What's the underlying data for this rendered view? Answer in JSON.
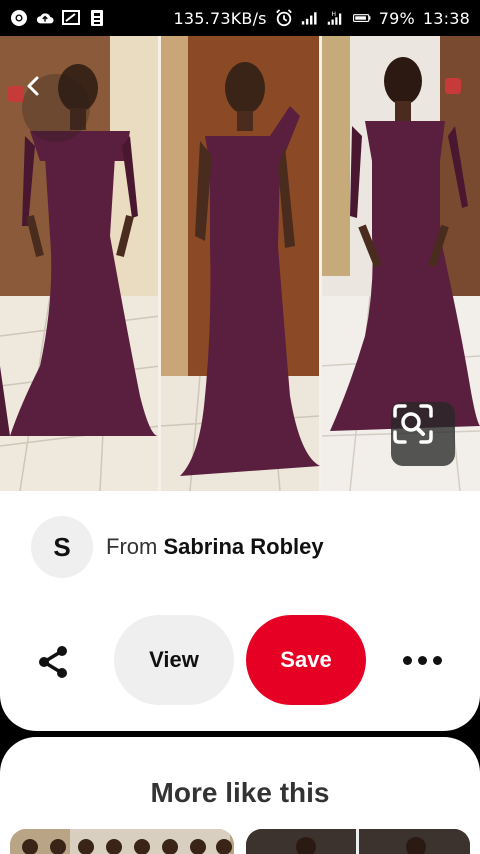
{
  "status_bar": {
    "speed": "135.73KB/s",
    "battery": "79%",
    "time": "13:38",
    "icons": [
      "chrome-icon",
      "cloud-upload-icon",
      "screen-cast-icon",
      "sim-icon",
      "alarm-icon",
      "signal-icon",
      "signal-h-icon",
      "battery-icon"
    ]
  },
  "pin": {
    "back_icon": "chevron-left-icon",
    "lens_icon": "visual-search-icon"
  },
  "creator": {
    "initial": "S",
    "prefix": "From ",
    "name": "Sabrina Robley"
  },
  "actions": {
    "view_label": "View",
    "save_label": "Save",
    "share_icon": "share-icon",
    "more_icon": "more-dots-icon"
  },
  "more_like_this": {
    "title": "More like this"
  },
  "colors": {
    "save": "#e60023",
    "view_bg": "#efefef",
    "dress": "#5a1f3e"
  }
}
